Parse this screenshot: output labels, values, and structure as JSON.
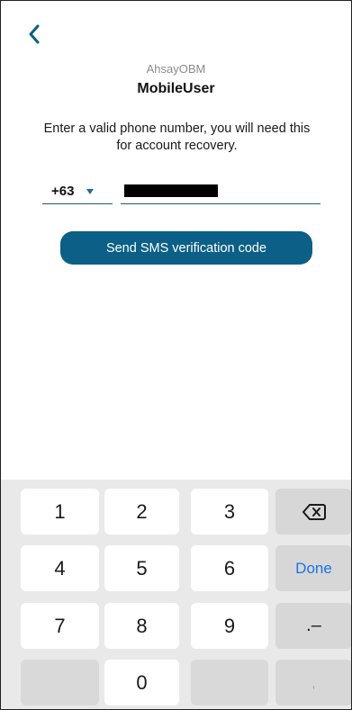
{
  "app": {
    "name": "AhsayOBM",
    "user": "MobileUser"
  },
  "form": {
    "instructions": "Enter a valid phone number, you will need this for account recovery.",
    "country_code": "+63",
    "phone_value_redacted": true,
    "send_button_label": "Send SMS verification code"
  },
  "keyboard": {
    "keys": {
      "k1": "1",
      "k2": "2",
      "k3": "3",
      "k4": "4",
      "k5": "5",
      "k6": "6",
      "k7": "7",
      "k8": "8",
      "k9": "9",
      "k0": "0",
      "done": "Done",
      "punct": ".–",
      "comma": ","
    },
    "icons": {
      "back": "chevron-left-icon",
      "backspace": "backspace-icon"
    }
  },
  "colors": {
    "accent": "#0c5f86",
    "back_arrow": "#0c5f86",
    "done_text": "#1a73e8",
    "keyboard_bg": "#e9e9e9"
  }
}
